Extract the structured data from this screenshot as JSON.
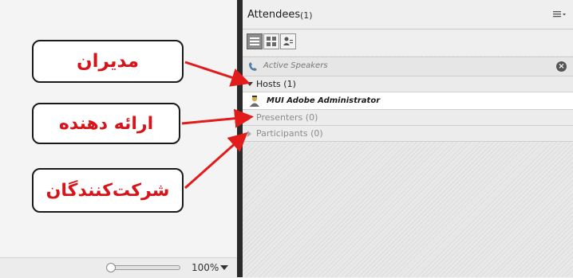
{
  "callouts": {
    "managers": "مدیران",
    "presenters": "ارائه دهنده",
    "participants": "شرکت‌کنندگان"
  },
  "status_bar": {
    "zoom": "100%"
  },
  "pod": {
    "title": "Attendees",
    "count": "(1)",
    "menu_icon": "menu-lines-icon"
  },
  "toolbar": {
    "buttons": [
      "list-view-icon",
      "grid-view-icon",
      "user-status-icon"
    ]
  },
  "active_speakers": {
    "label": "Active Speakers",
    "close": "×"
  },
  "sections": {
    "hosts": "Hosts (1)",
    "host_items": [
      {
        "name": "MUI Adobe Administrator"
      }
    ],
    "presenters": "Presenters (0)",
    "participants": "Participants (0)"
  },
  "colors": {
    "callout_text": "#d8141b",
    "arrow": "#e21b1b",
    "separator": "#2a2a2a"
  }
}
